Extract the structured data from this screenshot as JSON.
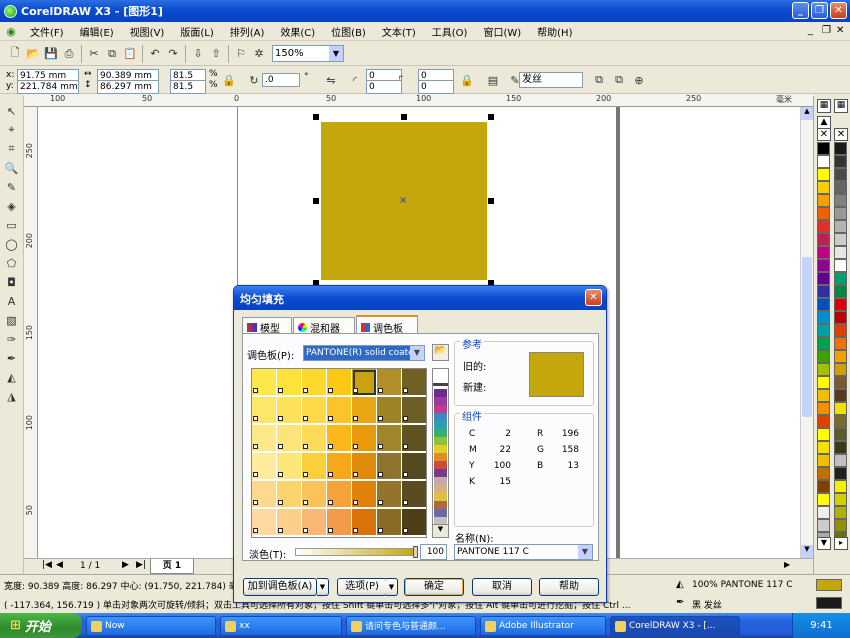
{
  "window": {
    "title": "CorelDRAW X3 - [图形1]"
  },
  "menu": [
    "文件(F)",
    "编辑(E)",
    "视图(V)",
    "版面(L)",
    "排列(A)",
    "效果(C)",
    "位图(B)",
    "文本(T)",
    "工具(O)",
    "窗口(W)",
    "帮助(H)"
  ],
  "toolbar": {
    "zoom": "150%"
  },
  "propbar": {
    "x": "91.75 mm",
    "y": "221.784 mm",
    "w": "90.389 mm",
    "h": "86.297 mm",
    "sx": "81.5",
    "sy": "81.5",
    "pct": "%",
    "angle": ".0",
    "off1": "0",
    "off2": "0",
    "outline": "发丝"
  },
  "ruler": {
    "top": [
      "100",
      "50",
      "0",
      "50",
      "100",
      "150",
      "200",
      "250"
    ],
    "unit": "毫米",
    "left": [
      "250",
      "200",
      "150",
      "100",
      "50"
    ]
  },
  "colors": {
    "fill": "#c4a60d",
    "accent": "#0a4cd0"
  },
  "pager": {
    "count": "1 / 1",
    "tab": "页 1"
  },
  "dialog": {
    "title": "均匀填充",
    "tabs": [
      "模型",
      "混和器",
      "调色板"
    ],
    "palette_label": "调色板(P):",
    "palette_value": "PANTONE(R) solid coated",
    "ref_label": "参考",
    "old_label": "旧的:",
    "new_label": "新建:",
    "comp_label": "组件",
    "cmyk": [
      {
        "k": "C",
        "v": "2"
      },
      {
        "k": "M",
        "v": "22"
      },
      {
        "k": "Y",
        "v": "100"
      },
      {
        "k": "K",
        "v": "15"
      }
    ],
    "rgb": [
      {
        "k": "R",
        "v": "196"
      },
      {
        "k": "G",
        "v": "158"
      },
      {
        "k": "B",
        "v": "13"
      }
    ],
    "tint_label": "淡色(T):",
    "tint_value": "100",
    "name_label": "名称(N):",
    "name_value": "PANTONE 117 C",
    "btn_add": "加到调色板(A)",
    "btn_options": "选项(P)",
    "btn_ok": "确定",
    "btn_cancel": "取消",
    "btn_help": "帮助"
  },
  "status": {
    "line1": "宽度: 90.389 高度: 86.297 中心: (91.750, 221.784) 毫",
    "line2": "( -117.364, 156.719 )  单击对象两次可旋转/倾斜；双击工具可选择所有对象；按住 Shift 键单击可选择多个对象；按住 Alt 键单击可进行挖掘；按住 Ctrl ...",
    "fill_info": "100% PANTONE 117 C",
    "outline_info": "黑 发丝"
  },
  "taskbar": {
    "start": "开始",
    "tasks": [
      "Now",
      "xx",
      "请问专色与普通颜...",
      "Adobe Illustrator",
      "CorelDRAW X3 - [..."
    ],
    "clock": "9:41"
  }
}
